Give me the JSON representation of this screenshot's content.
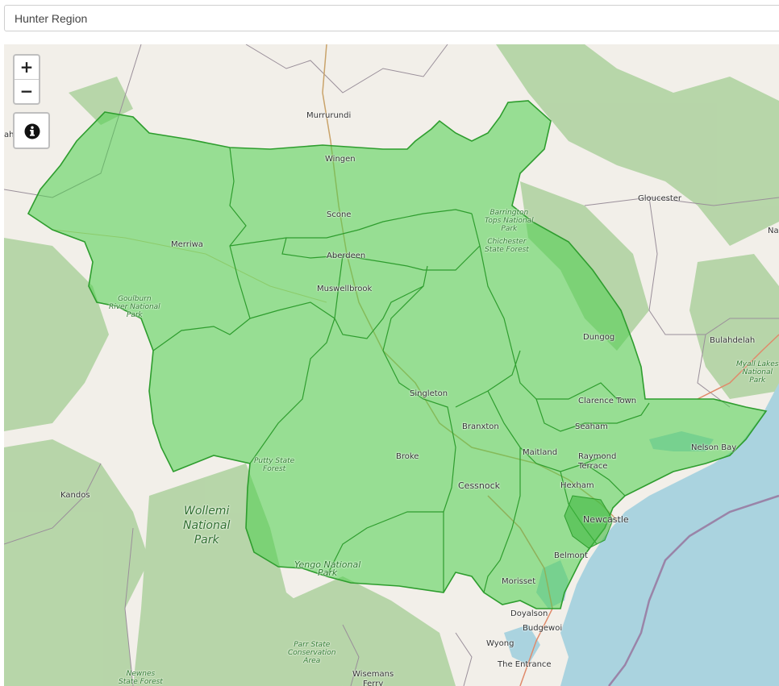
{
  "search": {
    "value": "Hunter Region"
  },
  "controls": {
    "zoom_in": "+",
    "zoom_out": "−",
    "info_icon": "info-circle-icon"
  },
  "colors": {
    "land": "#f2efe9",
    "ocean": "#aad3df",
    "forest": "#add19e",
    "region_fill": "#4ccf4c",
    "region_border": "#2e9d2e"
  },
  "places": {
    "murrurundi": "Murrurundi",
    "wingen": "Wingen",
    "scone": "Scone",
    "merriwa": "Merriwa",
    "aberdeen": "Aberdeen",
    "muswellbrook": "Muswellbrook",
    "gloucester": "Gloucester",
    "dungog": "Dungog",
    "bulahdelah": "Bulahdelah",
    "singleton": "Singleton",
    "clarence_town": "Clarence Town",
    "seaham": "Seaham",
    "branxton": "Branxton",
    "maitland": "Maitland",
    "raymond_terrace": "Raymond\nTerrace",
    "nelson_bay": "Nelson Bay",
    "broke": "Broke",
    "cessnock": "Cessnock",
    "hexham": "Hexham",
    "newcastle": "Newcastle",
    "kandos": "Kandos",
    "belmont": "Belmont",
    "morisset": "Morisset",
    "doyalson": "Doyalson",
    "budgewoi": "Budgewoi",
    "wyong": "Wyong",
    "the_entrance": "The Entrance",
    "wisemans_ferry": "Wisemans\nFerry",
    "edge_left": "ah",
    "edge_right": "Na"
  },
  "parks": {
    "barrington": "Barrington\nTops National\nPark",
    "chichester": "Chichester\nState Forest",
    "goulburn": "Goulburn\nRiver National\nPark",
    "putty": "Putty State\nForest",
    "wollemi": "Wollemi\nNational\nPark",
    "yengo": "Yengo National\nPark",
    "myall": "Myall Lakes\nNational\nPark",
    "parr": "Parr State\nConservation\nArea",
    "newnes": "Newnes\nState Forest"
  }
}
